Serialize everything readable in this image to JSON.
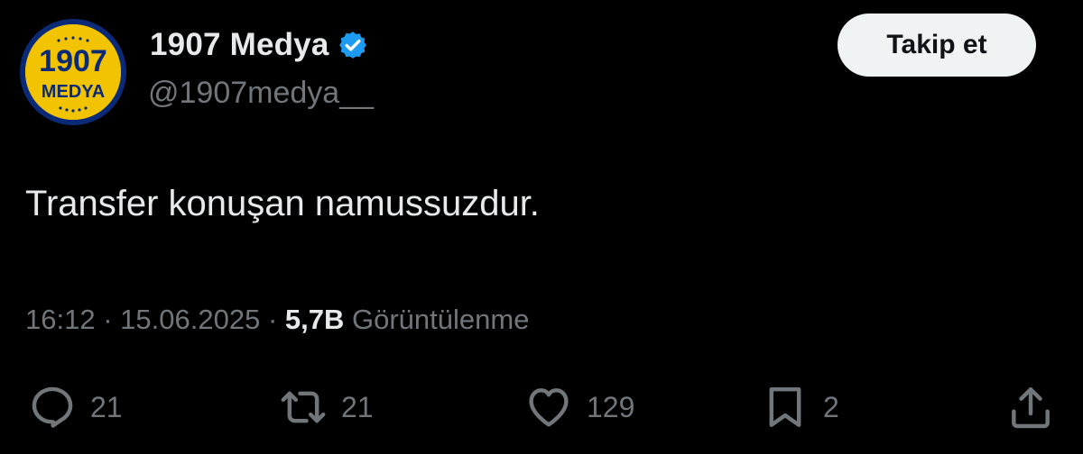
{
  "account": {
    "avatar_line1": "1907",
    "avatar_line2": "MEDYA",
    "display_name": "1907 Medya",
    "handle": "@1907medya__",
    "verified_icon": "verified-badge-icon",
    "verified_color": "#1d9bf0"
  },
  "follow_button": {
    "label": "Takip et"
  },
  "tweet": {
    "text": "Transfer konuşan namussuzdur.",
    "time": "16:12",
    "separator": "·",
    "date": "15.06.2025",
    "views_count": "5,7B",
    "views_label": "Görüntülenme"
  },
  "actions": {
    "reply": {
      "icon": "reply-icon",
      "count": "21"
    },
    "repost": {
      "icon": "repost-icon",
      "count": "21"
    },
    "like": {
      "icon": "heart-icon",
      "count": "129"
    },
    "bookmark": {
      "icon": "bookmark-icon",
      "count": "2"
    },
    "share": {
      "icon": "share-icon"
    }
  },
  "colors": {
    "background": "#000000",
    "primary_text": "#e7e9ea",
    "secondary_text": "#71767b",
    "avatar_yellow": "#f1c300",
    "avatar_navy": "#0a2a78"
  }
}
